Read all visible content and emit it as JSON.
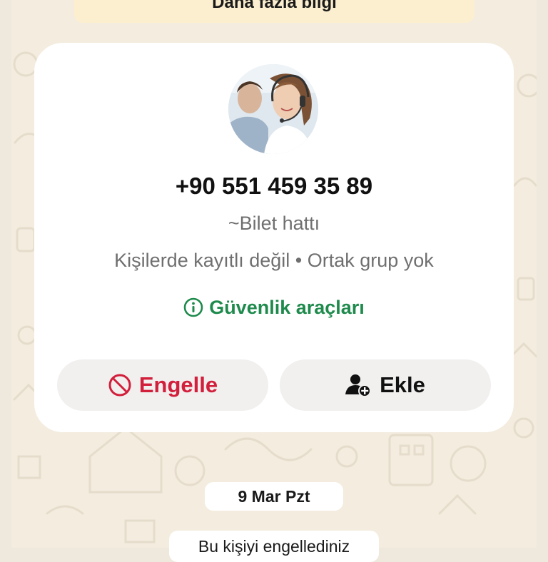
{
  "banner": {
    "text": "Daha fazla bilgi"
  },
  "contact": {
    "phone": "+90 551 459 35 89",
    "nickname": "~Bilet hattı",
    "info": "Kişilerde kayıtlı değil • Ortak grup yok",
    "safety_label": "Güvenlik araçları"
  },
  "actions": {
    "block_label": "Engelle",
    "add_label": "Ekle"
  },
  "chat": {
    "date": "9 Mar Pzt",
    "system_message": "Bu kişiyi engellediniz"
  },
  "colors": {
    "block": "#d21f3c",
    "safety": "#1e8a4c",
    "background": "#f3ecdf",
    "banner": "#fcefcf"
  },
  "icons": {
    "block": "block-icon",
    "add": "add-contact-icon",
    "safety": "info-icon"
  }
}
